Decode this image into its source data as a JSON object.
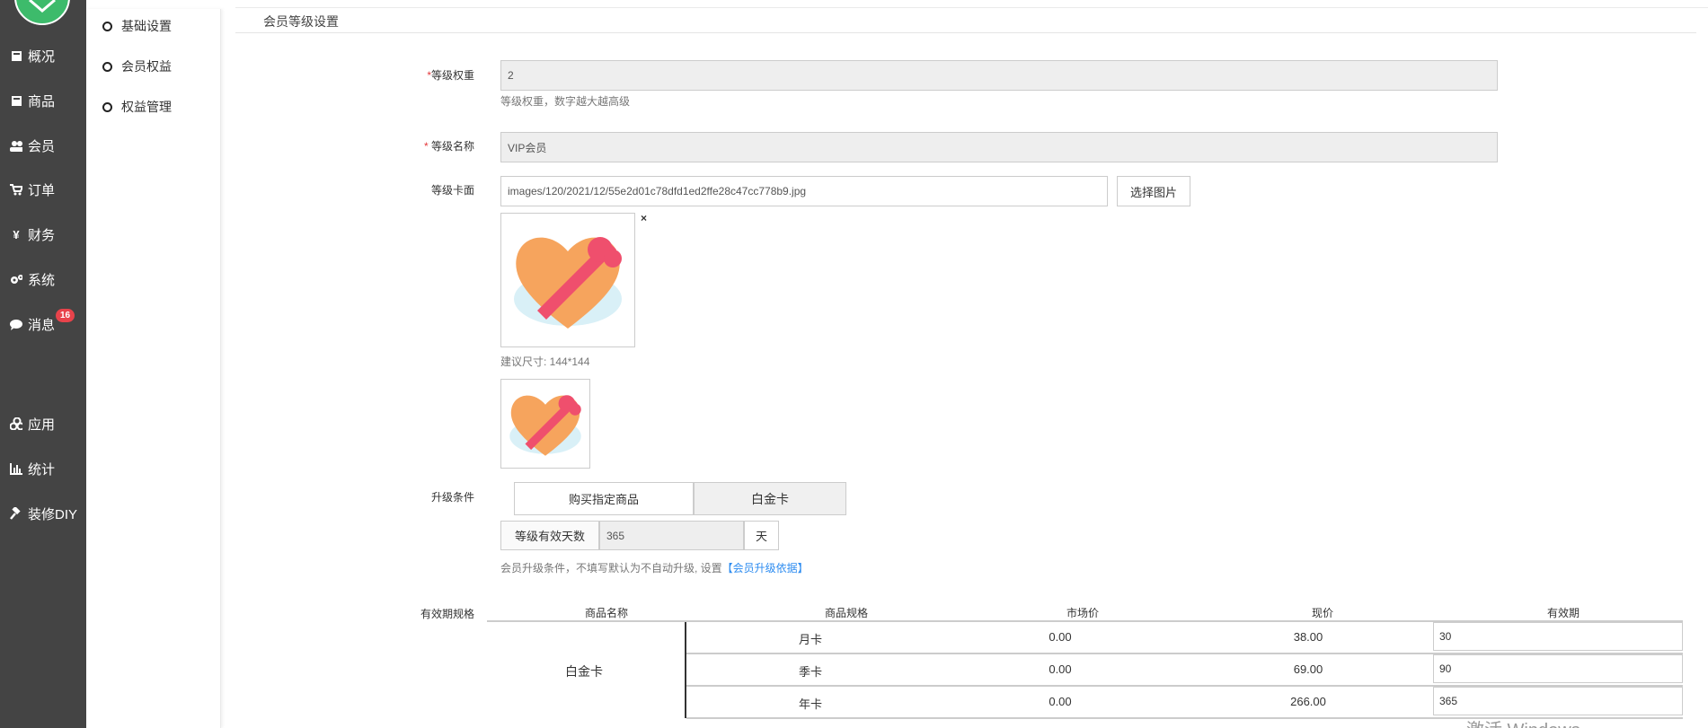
{
  "sidebar": {
    "items": [
      {
        "label": "概况",
        "icon": "overview-icon"
      },
      {
        "label": "商品",
        "icon": "goods-icon"
      },
      {
        "label": "会员",
        "icon": "members-icon"
      },
      {
        "label": "订单",
        "icon": "cart-icon"
      },
      {
        "label": "财务",
        "icon": "yen-icon"
      },
      {
        "label": "系统",
        "icon": "gears-icon"
      },
      {
        "label": "消息",
        "icon": "chat-icon",
        "badge": "16"
      },
      {
        "label": "应用",
        "icon": "apps-icon"
      },
      {
        "label": "统计",
        "icon": "bar-chart-icon"
      },
      {
        "label": "装修DIY",
        "icon": "gavel-icon"
      }
    ]
  },
  "submenu": {
    "items": [
      {
        "label": "基础设置"
      },
      {
        "label": "会员权益"
      },
      {
        "label": "权益管理"
      }
    ]
  },
  "page": {
    "title": "会员等级设置"
  },
  "form": {
    "weight": {
      "label": "等级权重",
      "required": "*",
      "value": "2",
      "help": "等级权重，数字越大越高级"
    },
    "name": {
      "label": "等级名称",
      "required": "*",
      "value": "VIP会员"
    },
    "card": {
      "label": "等级卡面",
      "path": "images/120/2021/12/55e2d01c78dfd1ed2ffe28c47cc778b9.jpg",
      "select_label": "选择图片",
      "remove": "×",
      "size_hint": "建议尺寸: 144*144"
    },
    "upgrade": {
      "label": "升级条件",
      "option_label": "购买指定商品",
      "option_value": "白金卡",
      "days_label": "等级有效天数",
      "days_value": "365",
      "days_unit": "天",
      "help_text": "会员升级条件，不填写默认为不自动升级, 设置",
      "help_link": "【会员升级依据】"
    }
  },
  "specs": {
    "label": "有效期规格",
    "headers": [
      "商品名称",
      "商品规格",
      "市场价",
      "现价",
      "有效期"
    ],
    "product": "白金卡",
    "rows": [
      {
        "spec": "月卡",
        "market": "0.00",
        "price": "38.00",
        "days": "30"
      },
      {
        "spec": "季卡",
        "market": "0.00",
        "price": "69.00",
        "days": "90"
      },
      {
        "spec": "年卡",
        "market": "0.00",
        "price": "266.00",
        "days": "365"
      }
    ]
  },
  "watermark": "激活 Windows",
  "colors": {
    "sidebar": "#444444",
    "brand": "#3dbb6b",
    "badge": "#e8434b",
    "link": "#2d8cf0"
  }
}
